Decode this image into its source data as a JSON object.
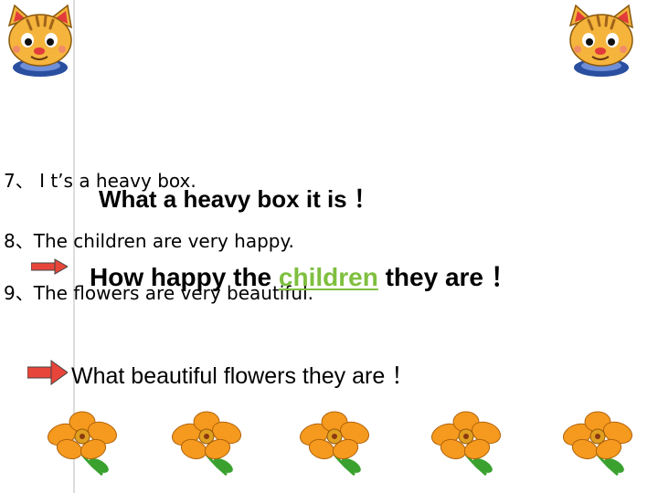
{
  "lines": [
    {
      "label": "7、 I t’s a heavy box.",
      "answer": "What a heavy box it is ！"
    },
    {
      "label": "8、The children are very happy.",
      "answer_pre": "How happy the ",
      "answer_em": "children",
      "answer_post": " they are ！"
    },
    {
      "label": "9、The flowers are very beautiful."
    }
  ],
  "bottom_answer": "What beautiful flowers they are ！",
  "colors": {
    "accent_green": "#7fbf3f",
    "arrow_red": "#e8453a",
    "flower_orange": "#f59a1e",
    "leaf_green": "#3aa12f"
  },
  "icons": [
    "cartoon-cat-mascot-icon",
    "orange-flower-icon",
    "red-arrow-icon"
  ]
}
